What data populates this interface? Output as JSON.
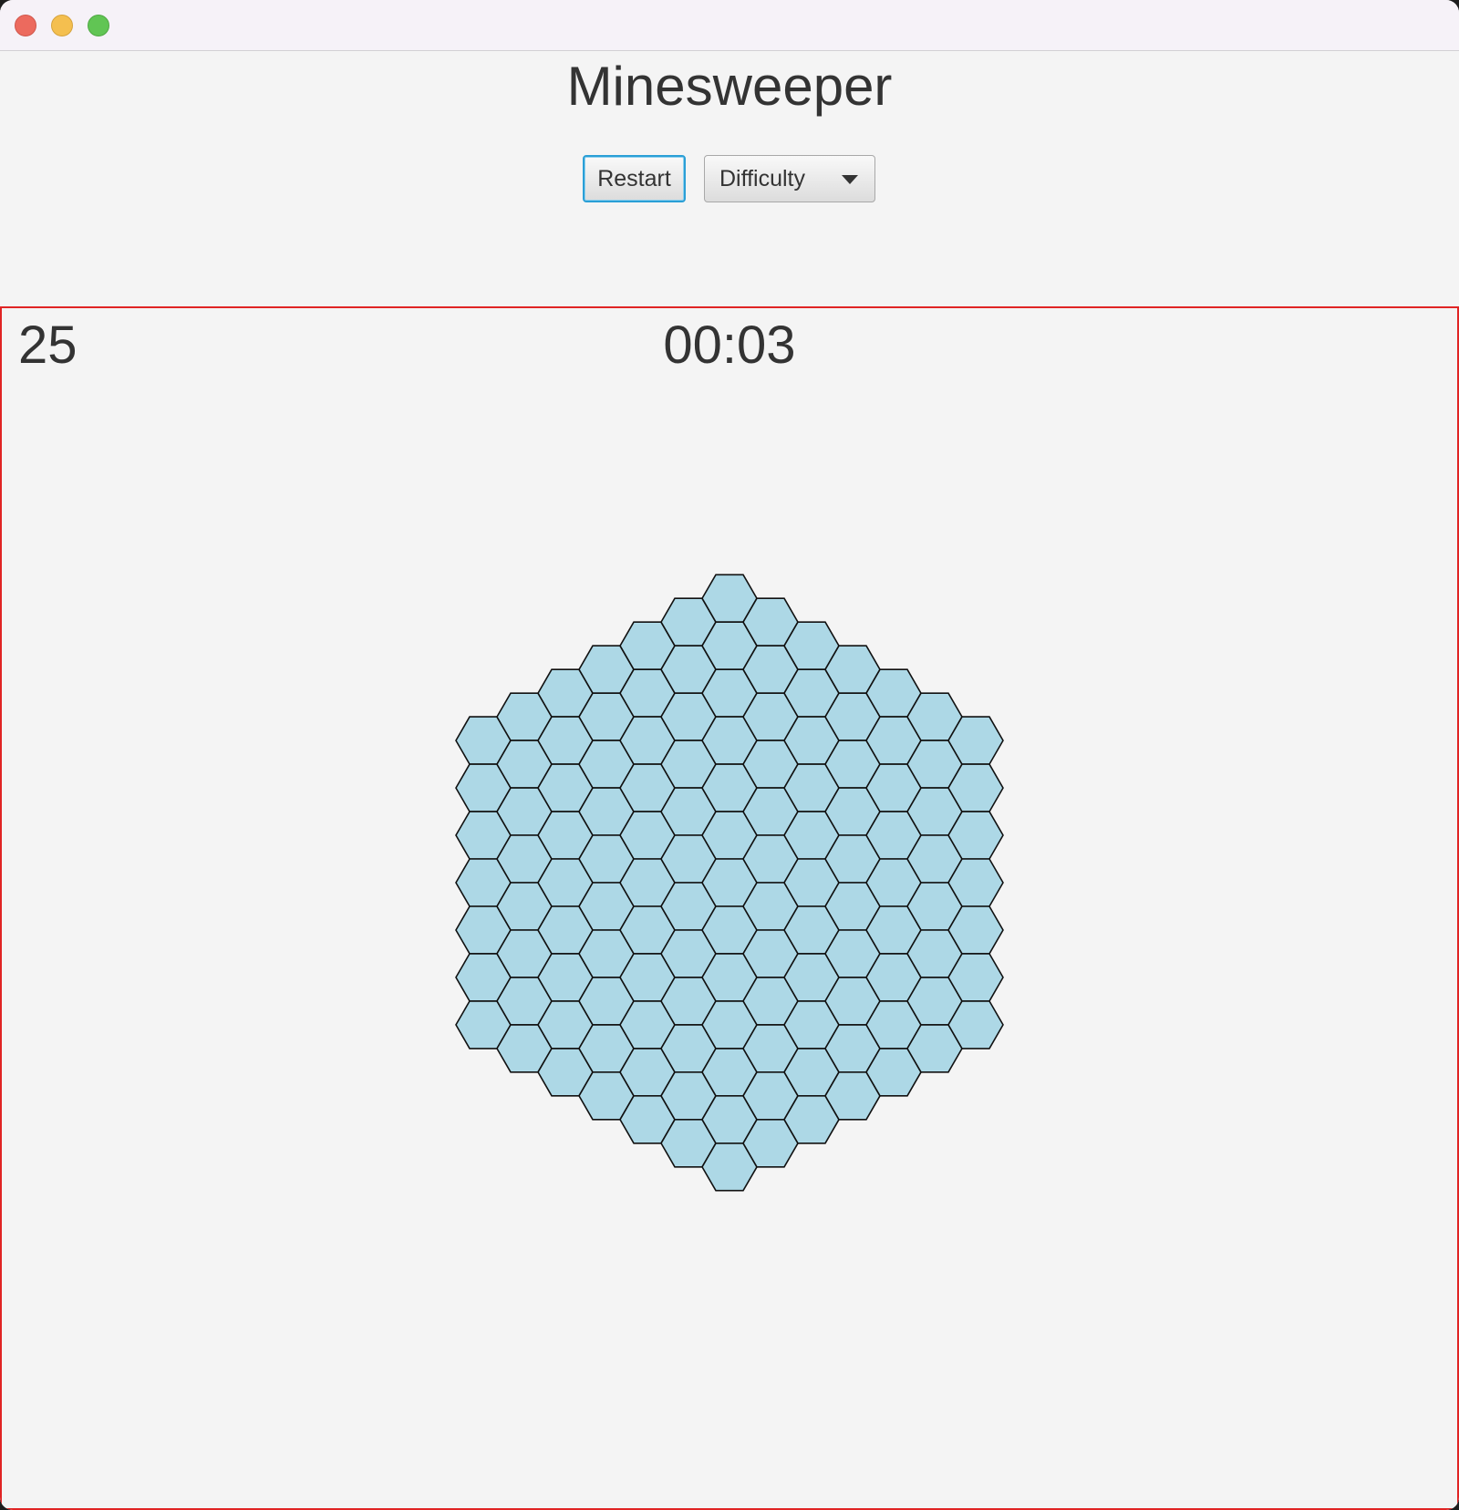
{
  "window": {
    "title_bar_buttons": [
      "close",
      "minimize",
      "maximize"
    ]
  },
  "app": {
    "title": "Minesweeper"
  },
  "toolbar": {
    "restart_label": "Restart",
    "difficulty_label": "Difficulty"
  },
  "game": {
    "mines_remaining": "25",
    "timer": "00:03",
    "board_radius": 6,
    "cell_state": "unrevealed",
    "colors": {
      "cell_fill": "#add8e6",
      "cell_stroke": "#111111",
      "panel_border": "#e02424",
      "focus_ring": "#2a9fd6"
    }
  }
}
